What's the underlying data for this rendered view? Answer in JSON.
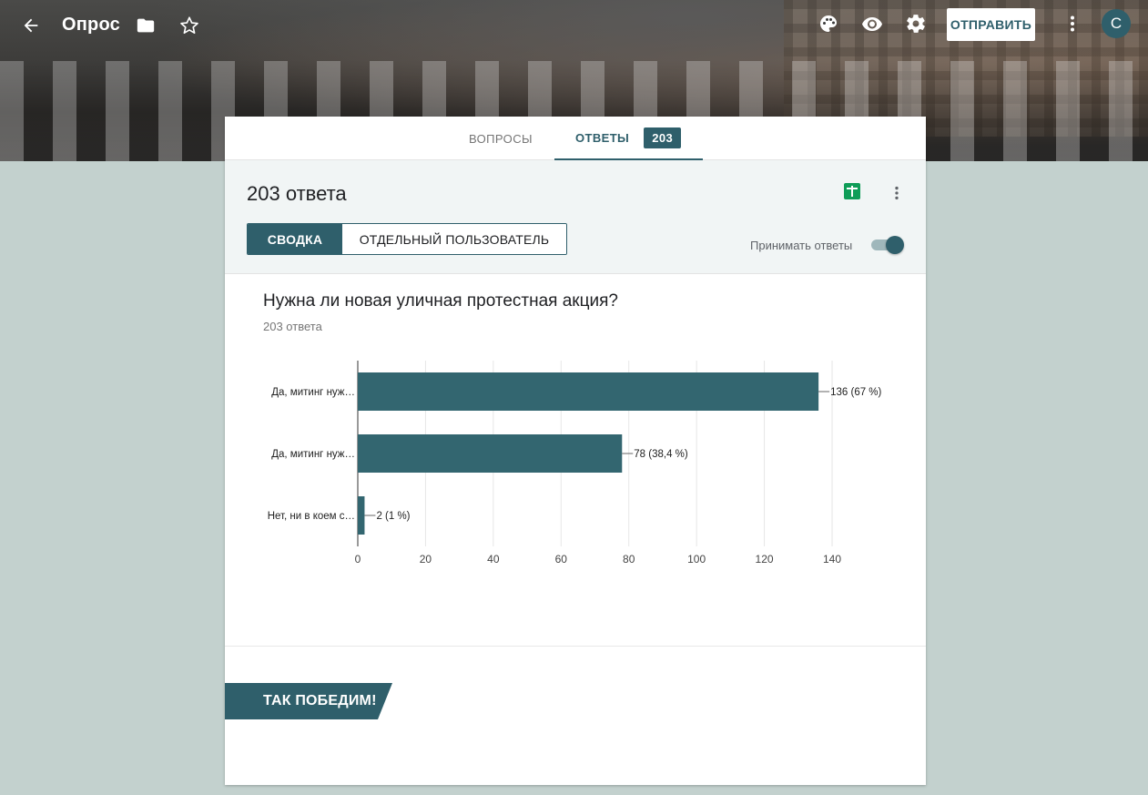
{
  "app": {
    "title": "Опрос",
    "send_label": "ОТПРАВИТЬ",
    "avatar_initial": "С",
    "accent_color": "#2f5f6b",
    "background_color": "#c3d1ce"
  },
  "icons": {
    "back": "arrow-left-icon",
    "folder": "folder-icon",
    "star": "star-outline-icon",
    "palette": "palette-icon",
    "preview": "eye-icon",
    "settings": "gear-icon",
    "more": "more-vertical-icon",
    "sheets": "sheets-icon"
  },
  "tabs": {
    "questions": "ВОПРОСЫ",
    "answers": "ОТВЕТЫ",
    "answers_count": "203"
  },
  "summary": {
    "heading": "203 ответа",
    "view_summary": "СВОДКА",
    "view_individual": "ОТДЕЛЬНЫЙ ПОЛЬЗОВАТЕЛЬ",
    "accept_label": "Принимать ответы",
    "accepting": true
  },
  "question": {
    "title": "Нужна ли новая уличная протестная акция?",
    "count": "203 ответа"
  },
  "chart_data": {
    "type": "bar",
    "orientation": "horizontal",
    "categories": [
      "Да, митинг нуж…",
      "Да, митинг нуж…",
      "Нет, ни в коем с…"
    ],
    "values": [
      136,
      78,
      2
    ],
    "data_labels": [
      "136 (67 %)",
      "78 (38,4 %)",
      "2 (1 %)"
    ],
    "xlim": [
      0,
      140
    ],
    "xticks": [
      0,
      20,
      40,
      60,
      80,
      100,
      120,
      140
    ],
    "grid": true,
    "bar_color": "#336670"
  },
  "footer": {
    "banner_text": "ТАК ПОБЕДИМ!"
  }
}
